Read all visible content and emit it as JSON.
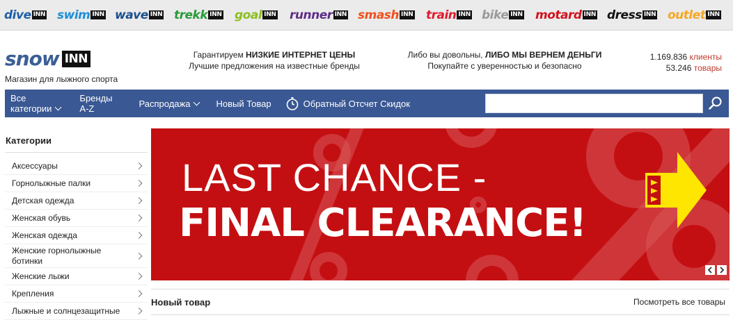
{
  "brands": [
    {
      "word": "dive",
      "inn": "INN",
      "color": "#1f5fa8"
    },
    {
      "word": "swim",
      "inn": "INN",
      "color": "#1e8fd8"
    },
    {
      "word": "wave",
      "inn": "INN",
      "color": "#1c4f8f"
    },
    {
      "word": "trekk",
      "inn": "INN",
      "color": "#2a9a3b"
    },
    {
      "word": "goal",
      "inn": "INN",
      "color": "#8cbf1e"
    },
    {
      "word": "runner",
      "inn": "INN",
      "color": "#5e2d86"
    },
    {
      "word": "smash",
      "inn": "INN",
      "color": "#f0501e"
    },
    {
      "word": "train",
      "inn": "INN",
      "color": "#e01b2e"
    },
    {
      "word": "bike",
      "inn": "INN",
      "color": "#9a9a9a"
    },
    {
      "word": "motard",
      "inn": "INN",
      "color": "#d3121f"
    },
    {
      "word": "dress",
      "inn": "INN",
      "color": "#111111"
    },
    {
      "word": "outlet",
      "inn": "INN",
      "color": "#f5a623"
    }
  ],
  "logo": {
    "word": "snow",
    "inn": "INN"
  },
  "tagline": "Магазин для лыжного спорта",
  "promo1": {
    "pre": "Гарантируем ",
    "bold": "НИЗКИЕ ИНТЕРНЕТ ЦЕНЫ",
    "line2": "Лучшие предложения на известные бренды"
  },
  "promo2": {
    "pre": "Либо вы довольны, ",
    "bold": "ЛИБО МЫ ВЕРНЕМ ДЕНЬГИ",
    "line2": "Покупайте с уверенностью и безопасно"
  },
  "stats": {
    "clients_num": "1.169.836",
    "clients_label": "клиенты",
    "products_num": "53.246",
    "products_label": "товары"
  },
  "nav": {
    "all_cat_1": "Все",
    "all_cat_2": "категории",
    "brands_1": "Бренды",
    "brands_2": "A-Z",
    "sale": "Распродажа",
    "new": "Новый Товар",
    "countdown": "Обратный Отсчет Скидок",
    "search_value": ""
  },
  "sidebar": {
    "title": "Категории",
    "items": [
      {
        "label": "Аксессуары",
        "h": 25
      },
      {
        "label": "Горнолыжные палки",
        "h": 25
      },
      {
        "label": "Детская одежда",
        "h": 25
      },
      {
        "label": "Женская обувь",
        "h": 25
      },
      {
        "label": "Женская одежда",
        "h": 25
      },
      {
        "label": "Женские горнолыжные ботинки",
        "h": 34
      },
      {
        "label": "Женские лыжи",
        "h": 25
      },
      {
        "label": "Крепления",
        "h": 25
      },
      {
        "label": "Лыжные и солнцезащитные",
        "h": 25
      }
    ]
  },
  "banner": {
    "line1": "LAST CHANCE -",
    "line2": "FINAL CLEARANCE!",
    "bg": "#c40f12"
  },
  "newproducts": {
    "title": "Новый товар",
    "link": "Посмотреть все товары"
  },
  "colors": {
    "nav": "#3a5893",
    "accent": "#c0392b",
    "logo": "#3b5f95"
  }
}
